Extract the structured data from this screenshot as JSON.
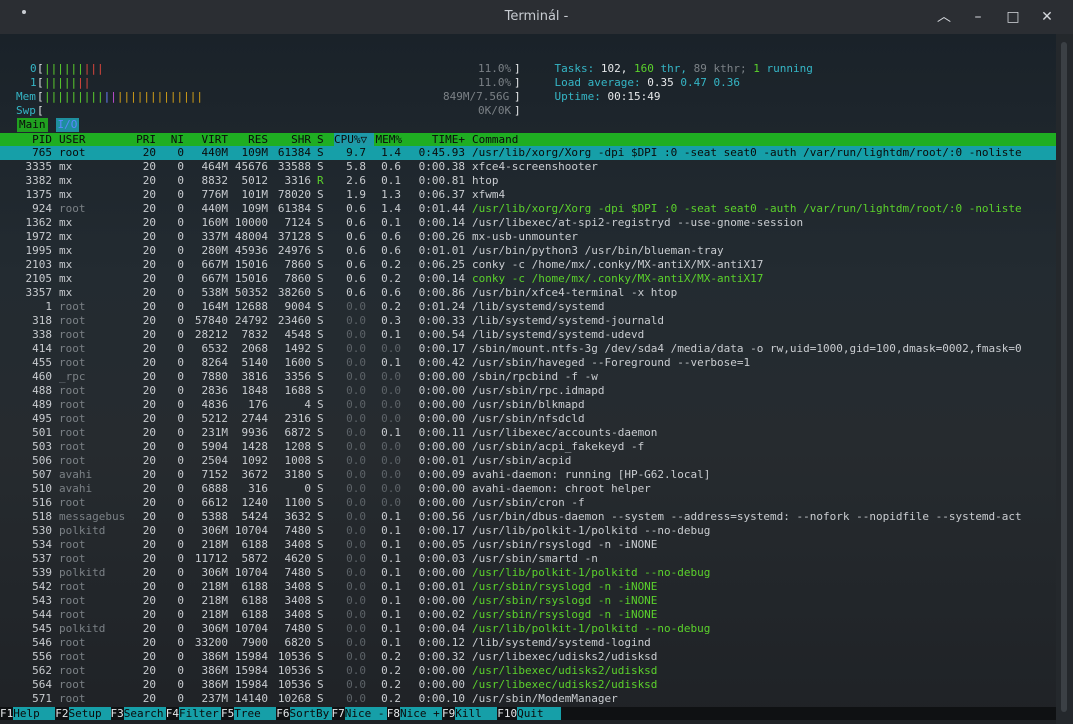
{
  "window": {
    "title": "Terminál -"
  },
  "meters": {
    "cpu0_label": "0",
    "cpu0_value": "11.0%",
    "cpu1_label": "1",
    "cpu1_value": "11.0%",
    "mem_label": "Mem",
    "mem_value": "849M/7.56G",
    "swp_label": "Swp",
    "swp_value": "0K/0K",
    "tasks_label": "Tasks:",
    "tasks_count": "102,",
    "thr_count": "160",
    "thr_text": "thr,",
    "kthr_text": "89 kthr;",
    "running_count": "1",
    "running_text": "running",
    "load_label": "Load average:",
    "load1": "0.35",
    "load5": "0.47",
    "load15": "0.36",
    "uptime_label": "Uptime:",
    "uptime_value": "00:15:49"
  },
  "tabs": {
    "main": "Main",
    "io": "I/O"
  },
  "columns": {
    "pid": "PID",
    "user": "USER",
    "pri": "PRI",
    "ni": "NI",
    "virt": "VIRT",
    "res": "RES",
    "shr": "SHR",
    "s": "S",
    "cpu": "CPU%▽",
    "mem": "MEM%",
    "time": "TIME+",
    "command": "Command"
  },
  "processes": [
    {
      "pid": "765",
      "user": "root",
      "pri": "20",
      "ni": "0",
      "virt": "440M",
      "res": "109M",
      "shr": "61384",
      "s": "S",
      "cpu": "9.7",
      "mem": "1.4",
      "time": "0:45.93",
      "cmd": "/usr/lib/xorg/Xorg -dpi $DPI :0 -seat seat0 -auth /var/run/lightdm/root/:0 -noliste"
    },
    {
      "pid": "3335",
      "user": "mx",
      "pri": "20",
      "ni": "0",
      "virt": "464M",
      "res": "45676",
      "shr": "33588",
      "s": "S",
      "cpu": "5.8",
      "mem": "0.6",
      "time": "0:00.38",
      "cmd": "xfce4-screenshooter"
    },
    {
      "pid": "3382",
      "user": "mx",
      "pri": "20",
      "ni": "0",
      "virt": "8832",
      "res": "5012",
      "shr": "3316",
      "s": "R",
      "cpu": "2.6",
      "mem": "0.1",
      "time": "0:00.81",
      "cmd": "htop"
    },
    {
      "pid": "1375",
      "user": "mx",
      "pri": "20",
      "ni": "0",
      "virt": "776M",
      "res": "101M",
      "shr": "78020",
      "s": "S",
      "cpu": "1.9",
      "mem": "1.3",
      "time": "0:06.37",
      "cmd": "xfwm4"
    },
    {
      "pid": "924",
      "user": "root",
      "pri": "20",
      "ni": "0",
      "virt": "440M",
      "res": "109M",
      "shr": "61384",
      "s": "S",
      "cpu": "0.6",
      "mem": "1.4",
      "time": "0:01.44",
      "cmd": "/usr/lib/xorg/Xorg -dpi $DPI :0 -seat seat0 -auth /var/run/lightdm/root/:0 -noliste"
    },
    {
      "pid": "1362",
      "user": "mx",
      "pri": "20",
      "ni": "0",
      "virt": "160M",
      "res": "10000",
      "shr": "7124",
      "s": "S",
      "cpu": "0.6",
      "mem": "0.1",
      "time": "0:00.14",
      "cmd": "/usr/libexec/at-spi2-registryd --use-gnome-session"
    },
    {
      "pid": "1972",
      "user": "mx",
      "pri": "20",
      "ni": "0",
      "virt": "337M",
      "res": "48004",
      "shr": "37128",
      "s": "S",
      "cpu": "0.6",
      "mem": "0.6",
      "time": "0:00.26",
      "cmd": "mx-usb-unmounter"
    },
    {
      "pid": "1995",
      "user": "mx",
      "pri": "20",
      "ni": "0",
      "virt": "280M",
      "res": "45936",
      "shr": "24976",
      "s": "S",
      "cpu": "0.6",
      "mem": "0.6",
      "time": "0:01.01",
      "cmd": "/usr/bin/python3 /usr/bin/blueman-tray"
    },
    {
      "pid": "2103",
      "user": "mx",
      "pri": "20",
      "ni": "0",
      "virt": "667M",
      "res": "15016",
      "shr": "7860",
      "s": "S",
      "cpu": "0.6",
      "mem": "0.2",
      "time": "0:06.25",
      "cmd": "conky -c /home/mx/.conky/MX-antiX/MX-antiX17"
    },
    {
      "pid": "2105",
      "user": "mx",
      "pri": "20",
      "ni": "0",
      "virt": "667M",
      "res": "15016",
      "shr": "7860",
      "s": "S",
      "cpu": "0.6",
      "mem": "0.2",
      "time": "0:00.14",
      "cmd": "conky -c /home/mx/.conky/MX-antiX/MX-antiX17"
    },
    {
      "pid": "3357",
      "user": "mx",
      "pri": "20",
      "ni": "0",
      "virt": "538M",
      "res": "50352",
      "shr": "38260",
      "s": "S",
      "cpu": "0.6",
      "mem": "0.6",
      "time": "0:00.86",
      "cmd": "/usr/bin/xfce4-terminal -x htop"
    },
    {
      "pid": "1",
      "user": "root",
      "pri": "20",
      "ni": "0",
      "virt": "164M",
      "res": "12688",
      "shr": "9004",
      "s": "S",
      "cpu": "0.0",
      "mem": "0.2",
      "time": "0:01.24",
      "cmd": "/lib/systemd/systemd"
    },
    {
      "pid": "318",
      "user": "root",
      "pri": "20",
      "ni": "0",
      "virt": "57840",
      "res": "24792",
      "shr": "23460",
      "s": "S",
      "cpu": "0.0",
      "mem": "0.3",
      "time": "0:00.33",
      "cmd": "/lib/systemd/systemd-journald"
    },
    {
      "pid": "338",
      "user": "root",
      "pri": "20",
      "ni": "0",
      "virt": "28212",
      "res": "7832",
      "shr": "4548",
      "s": "S",
      "cpu": "0.0",
      "mem": "0.1",
      "time": "0:00.54",
      "cmd": "/lib/systemd/systemd-udevd"
    },
    {
      "pid": "414",
      "user": "root",
      "pri": "20",
      "ni": "0",
      "virt": "6532",
      "res": "2068",
      "shr": "1492",
      "s": "S",
      "cpu": "0.0",
      "mem": "0.0",
      "time": "0:00.17",
      "cmd": "/sbin/mount.ntfs-3g /dev/sda4 /media/data -o rw,uid=1000,gid=100,dmask=0002,fmask=0"
    },
    {
      "pid": "455",
      "user": "root",
      "pri": "20",
      "ni": "0",
      "virt": "8264",
      "res": "5140",
      "shr": "1600",
      "s": "S",
      "cpu": "0.0",
      "mem": "0.1",
      "time": "0:00.42",
      "cmd": "/usr/sbin/haveged --Foreground --verbose=1"
    },
    {
      "pid": "460",
      "user": "_rpc",
      "pri": "20",
      "ni": "0",
      "virt": "7880",
      "res": "3816",
      "shr": "3356",
      "s": "S",
      "cpu": "0.0",
      "mem": "0.0",
      "time": "0:00.00",
      "cmd": "/sbin/rpcbind -f -w"
    },
    {
      "pid": "488",
      "user": "root",
      "pri": "20",
      "ni": "0",
      "virt": "2836",
      "res": "1848",
      "shr": "1688",
      "s": "S",
      "cpu": "0.0",
      "mem": "0.0",
      "time": "0:00.00",
      "cmd": "/usr/sbin/rpc.idmapd"
    },
    {
      "pid": "489",
      "user": "root",
      "pri": "20",
      "ni": "0",
      "virt": "4836",
      "res": "176",
      "shr": "4",
      "s": "S",
      "cpu": "0.0",
      "mem": "0.0",
      "time": "0:00.00",
      "cmd": "/usr/sbin/blkmapd"
    },
    {
      "pid": "495",
      "user": "root",
      "pri": "20",
      "ni": "0",
      "virt": "5212",
      "res": "2744",
      "shr": "2316",
      "s": "S",
      "cpu": "0.0",
      "mem": "0.0",
      "time": "0:00.00",
      "cmd": "/usr/sbin/nfsdcld"
    },
    {
      "pid": "501",
      "user": "root",
      "pri": "20",
      "ni": "0",
      "virt": "231M",
      "res": "9936",
      "shr": "6872",
      "s": "S",
      "cpu": "0.0",
      "mem": "0.1",
      "time": "0:00.11",
      "cmd": "/usr/libexec/accounts-daemon"
    },
    {
      "pid": "503",
      "user": "root",
      "pri": "20",
      "ni": "0",
      "virt": "5904",
      "res": "1428",
      "shr": "1208",
      "s": "S",
      "cpu": "0.0",
      "mem": "0.0",
      "time": "0:00.00",
      "cmd": "/usr/sbin/acpi_fakekeyd -f"
    },
    {
      "pid": "506",
      "user": "root",
      "pri": "20",
      "ni": "0",
      "virt": "2504",
      "res": "1092",
      "shr": "1008",
      "s": "S",
      "cpu": "0.0",
      "mem": "0.0",
      "time": "0:00.01",
      "cmd": "/usr/sbin/acpid"
    },
    {
      "pid": "507",
      "user": "avahi",
      "pri": "20",
      "ni": "0",
      "virt": "7152",
      "res": "3672",
      "shr": "3180",
      "s": "S",
      "cpu": "0.0",
      "mem": "0.0",
      "time": "0:00.09",
      "cmd": "avahi-daemon: running [HP-G62.local]"
    },
    {
      "pid": "510",
      "user": "avahi",
      "pri": "20",
      "ni": "0",
      "virt": "6888",
      "res": "316",
      "shr": "0",
      "s": "S",
      "cpu": "0.0",
      "mem": "0.0",
      "time": "0:00.00",
      "cmd": "avahi-daemon: chroot helper"
    },
    {
      "pid": "516",
      "user": "root",
      "pri": "20",
      "ni": "0",
      "virt": "6612",
      "res": "1240",
      "shr": "1100",
      "s": "S",
      "cpu": "0.0",
      "mem": "0.0",
      "time": "0:00.00",
      "cmd": "/usr/sbin/cron -f"
    },
    {
      "pid": "518",
      "user": "messagebus",
      "pri": "20",
      "ni": "0",
      "virt": "5388",
      "res": "5424",
      "shr": "3632",
      "s": "S",
      "cpu": "0.0",
      "mem": "0.1",
      "time": "0:00.56",
      "cmd": "/usr/bin/dbus-daemon --system --address=systemd: --nofork --nopidfile --systemd-act"
    },
    {
      "pid": "530",
      "user": "polkitd",
      "pri": "20",
      "ni": "0",
      "virt": "306M",
      "res": "10704",
      "shr": "7480",
      "s": "S",
      "cpu": "0.0",
      "mem": "0.1",
      "time": "0:00.17",
      "cmd": "/usr/lib/polkit-1/polkitd --no-debug"
    },
    {
      "pid": "534",
      "user": "root",
      "pri": "20",
      "ni": "0",
      "virt": "218M",
      "res": "6188",
      "shr": "3408",
      "s": "S",
      "cpu": "0.0",
      "mem": "0.1",
      "time": "0:00.05",
      "cmd": "/usr/sbin/rsyslogd -n -iNONE"
    },
    {
      "pid": "537",
      "user": "root",
      "pri": "20",
      "ni": "0",
      "virt": "11712",
      "res": "5872",
      "shr": "4620",
      "s": "S",
      "cpu": "0.0",
      "mem": "0.1",
      "time": "0:00.03",
      "cmd": "/usr/sbin/smartd -n"
    },
    {
      "pid": "539",
      "user": "polkitd",
      "pri": "20",
      "ni": "0",
      "virt": "306M",
      "res": "10704",
      "shr": "7480",
      "s": "S",
      "cpu": "0.0",
      "mem": "0.1",
      "time": "0:00.00",
      "cmd": "/usr/lib/polkit-1/polkitd --no-debug"
    },
    {
      "pid": "542",
      "user": "root",
      "pri": "20",
      "ni": "0",
      "virt": "218M",
      "res": "6188",
      "shr": "3408",
      "s": "S",
      "cpu": "0.0",
      "mem": "0.1",
      "time": "0:00.01",
      "cmd": "/usr/sbin/rsyslogd -n -iNONE"
    },
    {
      "pid": "543",
      "user": "root",
      "pri": "20",
      "ni": "0",
      "virt": "218M",
      "res": "6188",
      "shr": "3408",
      "s": "S",
      "cpu": "0.0",
      "mem": "0.1",
      "time": "0:00.00",
      "cmd": "/usr/sbin/rsyslogd -n -iNONE"
    },
    {
      "pid": "544",
      "user": "root",
      "pri": "20",
      "ni": "0",
      "virt": "218M",
      "res": "6188",
      "shr": "3408",
      "s": "S",
      "cpu": "0.0",
      "mem": "0.1",
      "time": "0:00.02",
      "cmd": "/usr/sbin/rsyslogd -n -iNONE"
    },
    {
      "pid": "545",
      "user": "polkitd",
      "pri": "20",
      "ni": "0",
      "virt": "306M",
      "res": "10704",
      "shr": "7480",
      "s": "S",
      "cpu": "0.0",
      "mem": "0.1",
      "time": "0:00.04",
      "cmd": "/usr/lib/polkit-1/polkitd --no-debug"
    },
    {
      "pid": "546",
      "user": "root",
      "pri": "20",
      "ni": "0",
      "virt": "33200",
      "res": "7900",
      "shr": "6820",
      "s": "S",
      "cpu": "0.0",
      "mem": "0.1",
      "time": "0:00.12",
      "cmd": "/lib/systemd/systemd-logind"
    },
    {
      "pid": "556",
      "user": "root",
      "pri": "20",
      "ni": "0",
      "virt": "386M",
      "res": "15984",
      "shr": "10536",
      "s": "S",
      "cpu": "0.0",
      "mem": "0.2",
      "time": "0:00.32",
      "cmd": "/usr/libexec/udisks2/udisksd"
    },
    {
      "pid": "562",
      "user": "root",
      "pri": "20",
      "ni": "0",
      "virt": "386M",
      "res": "15984",
      "shr": "10536",
      "s": "S",
      "cpu": "0.0",
      "mem": "0.2",
      "time": "0:00.00",
      "cmd": "/usr/libexec/udisks2/udisksd"
    },
    {
      "pid": "564",
      "user": "root",
      "pri": "20",
      "ni": "0",
      "virt": "386M",
      "res": "15984",
      "shr": "10536",
      "s": "S",
      "cpu": "0.0",
      "mem": "0.2",
      "time": "0:00.00",
      "cmd": "/usr/libexec/udisks2/udisksd"
    },
    {
      "pid": "571",
      "user": "root",
      "pri": "20",
      "ni": "0",
      "virt": "237M",
      "res": "14140",
      "shr": "10268",
      "s": "S",
      "cpu": "0.0",
      "mem": "0.2",
      "time": "0:00.10",
      "cmd": "/usr/sbin/ModemManager"
    }
  ],
  "footer": [
    {
      "key": "F1",
      "label": "Help"
    },
    {
      "key": "F2",
      "label": "Setup"
    },
    {
      "key": "F3",
      "label": "Search"
    },
    {
      "key": "F4",
      "label": "Filter"
    },
    {
      "key": "F5",
      "label": "Tree"
    },
    {
      "key": "F6",
      "label": "SortBy"
    },
    {
      "key": "F7",
      "label": "Nice -"
    },
    {
      "key": "F8",
      "label": "Nice +"
    },
    {
      "key": "F9",
      "label": "Kill"
    },
    {
      "key": "F10",
      "label": "Quit"
    }
  ]
}
